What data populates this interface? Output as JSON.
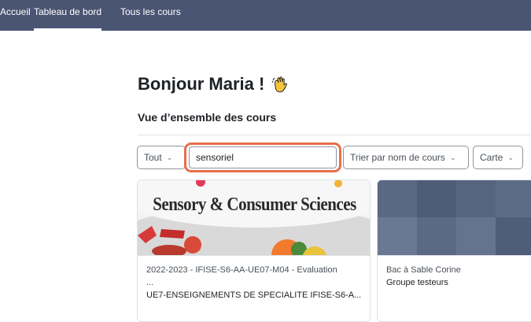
{
  "nav": {
    "items": [
      {
        "label": "Accueil",
        "active": false
      },
      {
        "label": "Tableau de bord",
        "active": true
      },
      {
        "label": "Tous les cours",
        "active": false
      }
    ]
  },
  "greeting": {
    "text": "Bonjour Maria !",
    "emoji": "waving-hand-icon"
  },
  "section_title": "Vue d’ensemble des cours",
  "controls": {
    "filter_label": "Tout",
    "search_value": "sensoriel",
    "sort_label": "Trier par nom de cours",
    "view_label": "Carte"
  },
  "courses": [
    {
      "image_text": "Sensory & Consumer Sciences",
      "name": "2022-2023 - IFISE-S6-AA-UE07-M04 - Evaluation",
      "name_cont": "...",
      "category": "UE7-ENSEIGNEMENTS DE SPECIALITE IFISE-S6-A..."
    },
    {
      "name": "Bac à Sable Corine",
      "category": "Groupe testeurs"
    }
  ],
  "colors": {
    "navbar": "#4a5573",
    "search_highlight": "#e96f49",
    "card2_pattern": "#54627e"
  }
}
